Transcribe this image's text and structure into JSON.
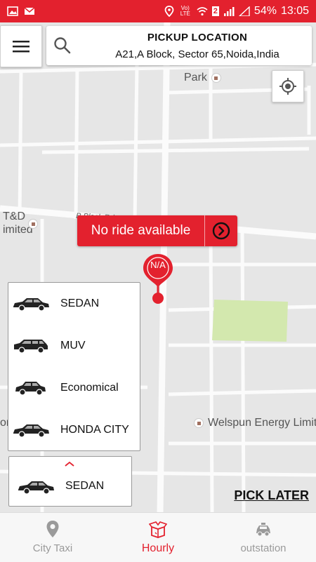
{
  "status_bar": {
    "network": "Vo) LTE",
    "sim_slot": "2",
    "battery": "54%",
    "time": "13:05"
  },
  "pickup": {
    "title": "PICKUP LOCATION",
    "address": "A21,A Block, Sector 65,Noida,India"
  },
  "map": {
    "labels": {
      "park": "Park",
      "road": "B Block Rd",
      "td_line1": "T&D",
      "td_line2": "imited",
      "welspun": "Welspun Energy Limit",
      "edge_left": "ora"
    }
  },
  "no_ride": {
    "text": "No ride available"
  },
  "pin": {
    "label": "N/A"
  },
  "car_types": [
    {
      "name": "SEDAN"
    },
    {
      "name": "MUV"
    },
    {
      "name": "Economical"
    },
    {
      "name": "HONDA CITY"
    }
  ],
  "selected_car": {
    "name": "SEDAN"
  },
  "pick_later": "PICK LATER",
  "bottom_nav": [
    {
      "label": "City Taxi",
      "icon": "location-pin-icon"
    },
    {
      "label": "Hourly",
      "icon": "package-box-icon"
    },
    {
      "label": "outstation",
      "icon": "taxi-icon"
    }
  ],
  "colors": {
    "brand": "#e3212e",
    "park_green": "#d3e8ae"
  }
}
